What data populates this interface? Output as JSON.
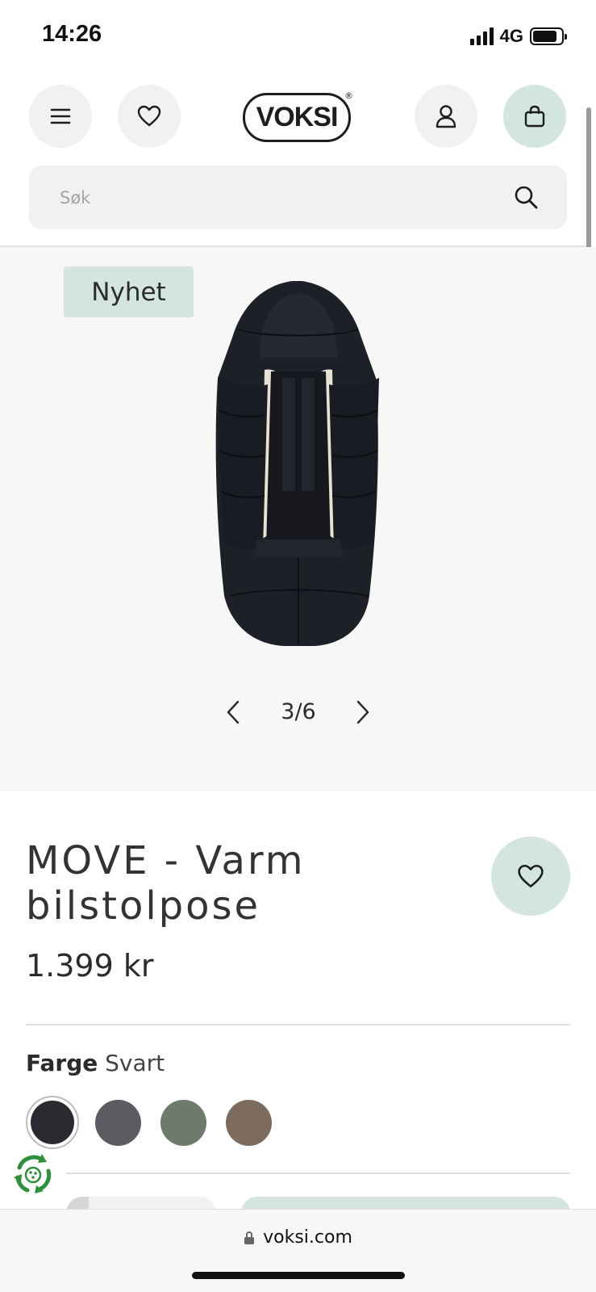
{
  "status_bar": {
    "time": "14:26",
    "network": "4G",
    "battery_level": 0.85
  },
  "header": {
    "logo": "VOKSI",
    "search": {
      "placeholder": "Søk",
      "value": ""
    },
    "icons": [
      "menu-icon",
      "heart-icon",
      "user-icon",
      "shopping-bag-icon",
      "search-icon"
    ]
  },
  "gallery": {
    "badge": "Nyhet",
    "counter": "3/6",
    "current": 3,
    "total": 6,
    "prev_icon": "chevron-left-icon",
    "next_icon": "chevron-right-icon"
  },
  "product": {
    "title": "MOVE - Varm bilstolpose",
    "price": "1.399 kr",
    "color_label": "Farge",
    "color_value": "Svart",
    "swatches": [
      {
        "name": "Svart",
        "hex": "#2a2b30",
        "selected": true
      },
      {
        "name": "grey",
        "hex": "#5b5c61",
        "selected": false
      },
      {
        "name": "green",
        "hex": "#6d7a6c",
        "selected": false
      },
      {
        "name": "brown",
        "hex": "#7d6c5e",
        "selected": false
      }
    ]
  },
  "colors": {
    "accent_mint": "#d3e5de",
    "button_grey": "#f1f1f1",
    "text": "#2b2b2b"
  },
  "browser": {
    "url": "voksi.com"
  }
}
